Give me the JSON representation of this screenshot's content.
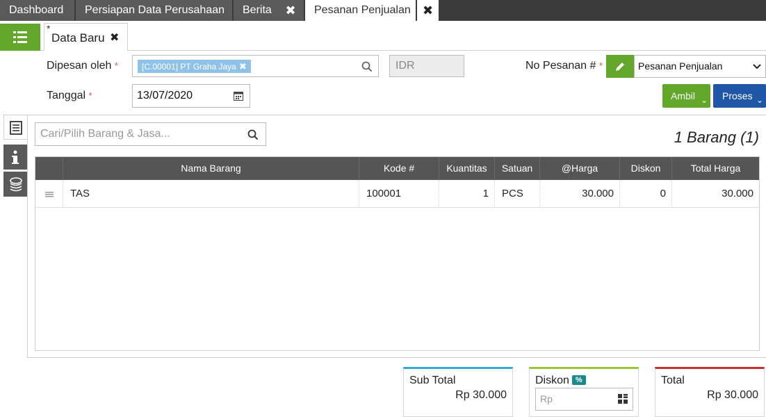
{
  "top_tabs": [
    {
      "label": "Dashboard"
    },
    {
      "label": "Persiapan Data Perusahaan"
    },
    {
      "label": "Berita"
    },
    {
      "label": "Pesanan Penjualan"
    }
  ],
  "sub_tab": {
    "star": "*",
    "label": "Data Baru"
  },
  "form": {
    "ordered_by_label": "Dipesan oleh",
    "required_mark": "*",
    "customer_chip": "[C.00001] PT Graha Jaya",
    "currency": "IDR",
    "order_no_label": "No Pesanan #",
    "order_type_value": "Pesanan Penjualan",
    "date_label": "Tanggal",
    "date_value": "13/07/2020"
  },
  "actions": {
    "ambil": "Ambil",
    "proses": "Proses"
  },
  "items": {
    "search_placeholder": "Cari/Pilih Barang & Jasa...",
    "count_label": "1 Barang (1)",
    "columns": [
      "Nama Barang",
      "Kode #",
      "Kuantitas",
      "Satuan",
      "@Harga",
      "Diskon",
      "Total Harga"
    ],
    "rows": [
      {
        "name": "TAS",
        "code": "100001",
        "qty": "1",
        "unit": "PCS",
        "price": "30.000",
        "discount": "0",
        "total": "30.000"
      }
    ]
  },
  "summary": {
    "subtotal_label": "Sub Total",
    "subtotal_value": "Rp 30.000",
    "discount_label": "Diskon",
    "discount_badge": "%",
    "discount_placeholder": "Rp",
    "total_label": "Total",
    "total_value": "Rp 30.000"
  },
  "colors": {
    "green": "#62a72a",
    "blue": "#1f57a6",
    "header_dark": "#3b3b3b"
  },
  "icons": [
    "list-icon",
    "close-icon",
    "search-icon",
    "pencil-icon",
    "calendar-icon",
    "chevron-down-icon",
    "document-icon",
    "info-icon",
    "coins-icon",
    "drag-handle-icon",
    "calculator-icon"
  ]
}
